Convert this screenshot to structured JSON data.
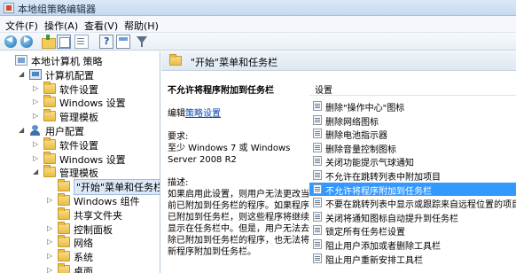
{
  "window": {
    "title": "本地组策略编辑器"
  },
  "menu": [
    {
      "label": "文件(F)"
    },
    {
      "label": "操作(A)"
    },
    {
      "label": "查看(V)"
    },
    {
      "label": "帮助(H)"
    }
  ],
  "tree": [
    {
      "label": "本地计算机 策略",
      "icon": "policy-icon",
      "level": 0,
      "expander": ""
    },
    {
      "label": "计算机配置",
      "icon": "computer-icon",
      "level": 1,
      "expander": "expanded"
    },
    {
      "label": "软件设置",
      "icon": "folder-icon",
      "level": 2,
      "expander": "collapsed"
    },
    {
      "label": "Windows 设置",
      "icon": "folder-icon",
      "level": 2,
      "expander": "collapsed"
    },
    {
      "label": "管理模板",
      "icon": "folder-icon",
      "level": 2,
      "expander": "collapsed"
    },
    {
      "label": "用户配置",
      "icon": "user-icon",
      "level": 1,
      "expander": "expanded"
    },
    {
      "label": "软件设置",
      "icon": "folder-icon",
      "level": 2,
      "expander": "collapsed"
    },
    {
      "label": "Windows 设置",
      "icon": "folder-icon",
      "level": 2,
      "expander": "collapsed"
    },
    {
      "label": "管理模板",
      "icon": "folder-icon",
      "level": 2,
      "expander": "expanded"
    },
    {
      "label": "\"开始\"菜单和任务栏",
      "icon": "folder-icon",
      "level": 3,
      "expander": "",
      "selected": true
    },
    {
      "label": "Windows 组件",
      "icon": "folder-icon",
      "level": 3,
      "expander": "collapsed"
    },
    {
      "label": "共享文件夹",
      "icon": "folder-icon",
      "level": 3,
      "expander": ""
    },
    {
      "label": "控制面板",
      "icon": "folder-icon",
      "level": 3,
      "expander": "collapsed"
    },
    {
      "label": "网络",
      "icon": "folder-icon",
      "level": 3,
      "expander": "collapsed"
    },
    {
      "label": "系统",
      "icon": "folder-icon",
      "level": 3,
      "expander": "collapsed"
    },
    {
      "label": "桌面",
      "icon": "folder-icon",
      "level": 3,
      "expander": "collapsed"
    }
  ],
  "right_pane": {
    "header": "\"开始\"菜单和任务栏",
    "description": {
      "setting_title": "不允许将程序附加到任务栏",
      "edit_prefix": "编辑",
      "edit_link": "策略设置",
      "requirements_label": "要求:",
      "requirements_lines": [
        "至少 Windows 7 或 Windows",
        "Server 2008 R2"
      ],
      "description_label": "描述:",
      "description_lines": [
        "如果启用此设置，则用户无法更改当",
        "前已附加到任务栏的程序。如果程序",
        "已附加到任务栏，则这些程序将继续",
        "显示在任务栏中。但是，用户无法去",
        "除已附加到任务栏的程序，也无法将",
        "新程序附加到任务栏。"
      ]
    },
    "list": {
      "column_header": "设置",
      "items": [
        {
          "label": "删除\"操作中心\"图标"
        },
        {
          "label": "删除网络图标"
        },
        {
          "label": "删除电池指示器"
        },
        {
          "label": "删除音量控制图标"
        },
        {
          "label": "关闭功能提示气球通知"
        },
        {
          "label": "不允许在跳转列表中附加项目"
        },
        {
          "label": "不允许将程序附加到任务栏",
          "selected": true
        },
        {
          "label": "不要在跳转列表中显示或跟踪来自远程位置的项目"
        },
        {
          "label": "关闭将通知图标自动提升到任务栏"
        },
        {
          "label": "锁定所有任务栏设置"
        },
        {
          "label": "阻止用户添加或者删除工具栏"
        },
        {
          "label": "阻止用户重新安排工具栏"
        }
      ]
    }
  }
}
